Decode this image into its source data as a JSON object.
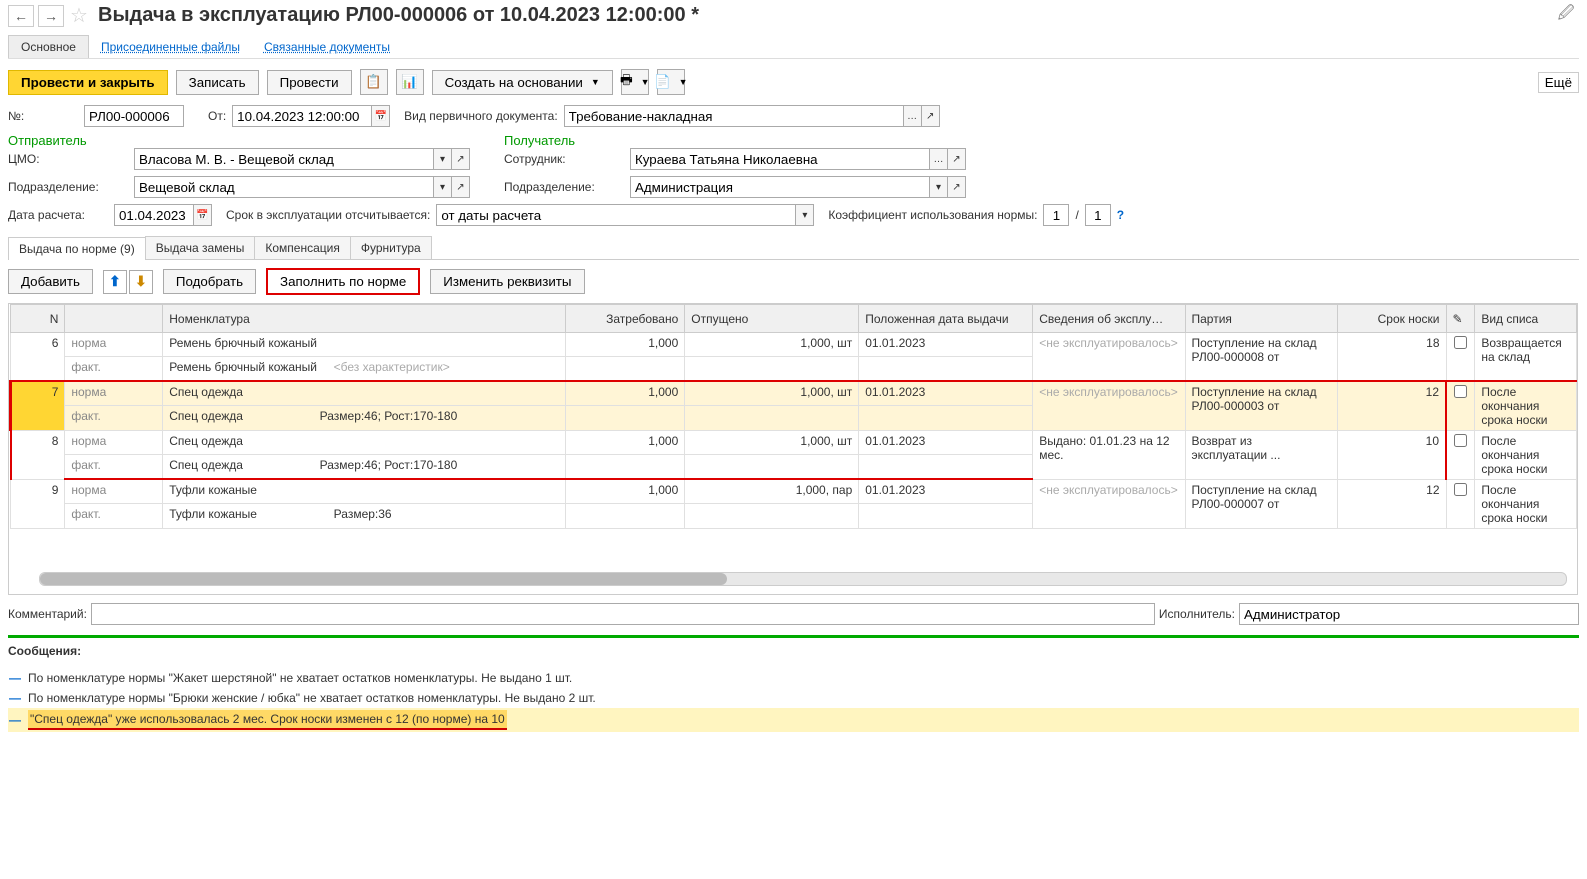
{
  "header": {
    "title": "Выдача в эксплуатацию РЛ00-000006 от 10.04.2023 12:00:00 *"
  },
  "topTabs": {
    "main": "Основное",
    "attached": "Присоединенные файлы",
    "linked": "Связанные документы"
  },
  "toolbar": {
    "postClose": "Провести и закрыть",
    "save": "Записать",
    "post": "Провести",
    "createBased": "Создать на основании",
    "more": "Ещё"
  },
  "form": {
    "numberLabel": "№:",
    "number": "РЛ00-000006",
    "fromLabel": "От:",
    "date": "10.04.2023 12:00:00",
    "primaryDocLabel": "Вид первичного документа:",
    "primaryDoc": "Требование-накладная",
    "senderTitle": "Отправитель",
    "receiverTitle": "Получатель",
    "cmoLabel": "ЦМО:",
    "cmo": "Власова М. В. - Вещевой склад",
    "employeeLabel": "Сотрудник:",
    "employee": "Кураева Татьяна Николаевна",
    "deptLabel": "Подразделение:",
    "deptSend": "Вещевой склад",
    "deptRecv": "Администрация",
    "calcDateLabel": "Дата расчета:",
    "calcDate": "01.04.2023",
    "termLabel": "Срок в эксплуатации отсчитывается:",
    "termValue": "от даты расчета",
    "coefLabel": "Коэффициент использования нормы:",
    "coefNum": "1",
    "coefSlash": "/",
    "coefDenom": "1",
    "help": "?"
  },
  "subTabs": {
    "byNorm": "Выдача по норме (9)",
    "replace": "Выдача замены",
    "compensation": "Компенсация",
    "furniture": "Фурнитура"
  },
  "tableToolbar": {
    "add": "Добавить",
    "select": "Подобрать",
    "fillByNorm": "Заполнить по норме",
    "changeProps": "Изменить реквизиты"
  },
  "tableHeaders": {
    "n": "N",
    "nomenclature": "Номенклатура",
    "requested": "Затребовано",
    "released": "Отпущено",
    "dueDate": "Положенная дата выдачи",
    "usageInfo": "Сведения об эксплу…",
    "batch": "Партия",
    "wearPeriod": "Срок носки",
    "writeOff": "Вид списа"
  },
  "rows": [
    {
      "n": "6",
      "typeN": "норма",
      "typeF": "факт.",
      "itemN": "Ремень брючный кожаный",
      "itemF": "Ремень брючный кожаный",
      "charF": "<без характеристик>",
      "req": "1,000",
      "rel": "1,000, шт",
      "due": "01.01.2023",
      "usage": "<не эксплуатировалось>",
      "batch": "Поступление на склад РЛ00-000008 от",
      "period": "18",
      "writeOff": "Возвращается на склад"
    },
    {
      "n": "7",
      "typeN": "норма",
      "typeF": "факт.",
      "itemN": "Спец одежда",
      "itemF": "Спец одежда",
      "charF": "Размер:46; Рост:170-180",
      "req": "1,000",
      "rel": "1,000, шт",
      "due": "01.01.2023",
      "usage": "<не эксплуатировалось>",
      "batch": "Поступление на склад РЛ00-000003 от",
      "period": "12",
      "writeOff": "После окончания срока носки"
    },
    {
      "n": "8",
      "typeN": "норма",
      "typeF": "факт.",
      "itemN": "Спец одежда",
      "itemF": "Спец одежда",
      "charF": "Размер:46; Рост:170-180",
      "req": "1,000",
      "rel": "1,000, шт",
      "due": "01.01.2023",
      "usage": "Выдано: 01.01.23 на 12 мес.",
      "batch": "Возврат из эксплуатации ...",
      "period": "10",
      "writeOff": "После окончания срока носки"
    },
    {
      "n": "9",
      "typeN": "норма",
      "typeF": "факт.",
      "itemN": "Туфли кожаные",
      "itemF": "Туфли кожаные",
      "charF": "Размер:36",
      "req": "1,000",
      "rel": "1,000, пар",
      "due": "01.01.2023",
      "usage": "<не эксплуатировалось>",
      "batch": "Поступление на склад РЛ00-000007 от",
      "period": "12",
      "writeOff": "После окончания срока носки"
    }
  ],
  "comment": {
    "label": "Комментарий:"
  },
  "executor": {
    "label": "Исполнитель:",
    "value": "Администратор"
  },
  "messages": {
    "title": "Сообщения:",
    "m1": "По номенклатуре нормы \"Жакет шерстяной\" не хватает остатков номенклатуры. Не выдано 1 шт.",
    "m2": "По номенклатуре нормы \"Брюки женские / юбка\" не хватает остатков номенклатуры. Не выдано 2 шт.",
    "m3": "\"Спец одежда\" уже использовалась 2 мес. Срок носки изменен с 12 (по норме) на 10"
  }
}
